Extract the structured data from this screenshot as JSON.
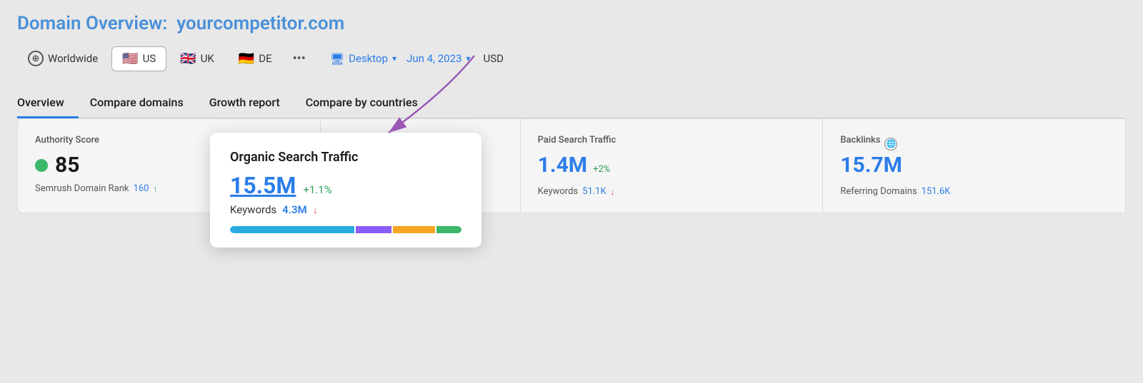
{
  "header": {
    "prefix": "Domain Overview:",
    "domain": "yourcompetitor.com"
  },
  "filterBar": {
    "worldwide_label": "Worldwide",
    "us_label": "US",
    "uk_label": "UK",
    "de_label": "DE",
    "more_label": "•••",
    "desktop_label": "Desktop",
    "date_label": "Jun 4, 2023",
    "currency_label": "USD"
  },
  "tabs": [
    {
      "id": "overview",
      "label": "Overview",
      "active": true
    },
    {
      "id": "compare-domains",
      "label": "Compare domains",
      "active": false
    },
    {
      "id": "growth-report",
      "label": "Growth report",
      "active": false
    },
    {
      "id": "compare-countries",
      "label": "Compare by countries",
      "active": false
    }
  ],
  "cards": [
    {
      "id": "authority-score",
      "label": "Authority Score",
      "score": "85",
      "sub_label": "Semrush Domain Rank",
      "sub_value": "160",
      "sub_trend": "up"
    },
    {
      "id": "organic-search",
      "label": "Organic Search Traffic",
      "value": "15.5M",
      "change": "+1.1%",
      "change_type": "positive",
      "keywords_label": "Keywords",
      "keywords_value": "4.3M",
      "keywords_trend": "down"
    },
    {
      "id": "paid-search",
      "label": "Paid Search Traffic",
      "value": "1.4M",
      "change": "+2%",
      "change_type": "positive",
      "keywords_label": "Keywords",
      "keywords_value": "51.1K",
      "keywords_trend": "down"
    },
    {
      "id": "backlinks",
      "label": "Backlinks",
      "value": "15.7M",
      "sub_label": "Referring Domains",
      "sub_value": "151.6K"
    }
  ],
  "tooltip": {
    "title": "Organic Search Traffic",
    "value": "15.5M",
    "change": "+1.1%",
    "keywords_label": "Keywords",
    "keywords_value": "4.3M",
    "keywords_trend": "down",
    "progress_segments": [
      {
        "color": "blue",
        "width": 55
      },
      {
        "color": "purple",
        "width": 15
      },
      {
        "color": "yellow",
        "width": 20
      },
      {
        "color": "green",
        "width": 10
      }
    ]
  },
  "colors": {
    "accent_blue": "#2b7de9",
    "positive_green": "#2e9e5b",
    "negative_red": "#e04444",
    "arrow_purple": "#9b59b6"
  }
}
